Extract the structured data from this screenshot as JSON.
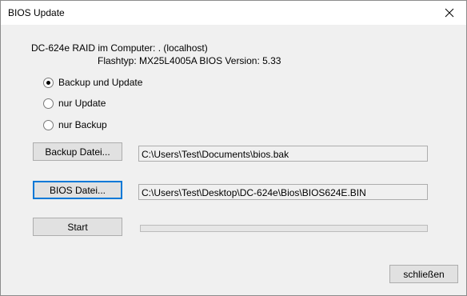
{
  "window": {
    "title": "BIOS Update",
    "close_glyph": "✕"
  },
  "info": {
    "line1": "DC-624e RAID  im Computer: . (localhost)",
    "line2": "Flashtyp: MX25L4005A   BIOS Version: 5.33"
  },
  "options": [
    {
      "label": "Backup und Update",
      "checked": true
    },
    {
      "label": "nur Update",
      "checked": false
    },
    {
      "label": "nur Backup",
      "checked": false
    }
  ],
  "backup": {
    "button_label": "Backup Datei...",
    "path": "C:\\Users\\Test\\Documents\\bios.bak"
  },
  "bios": {
    "button_label": "BIOS Datei...",
    "path": "C:\\Users\\Test\\Desktop\\DC-624e\\Bios\\BIOS624E.BIN"
  },
  "start": {
    "button_label": "Start",
    "progress": 0
  },
  "close_button_label": "schließen"
}
